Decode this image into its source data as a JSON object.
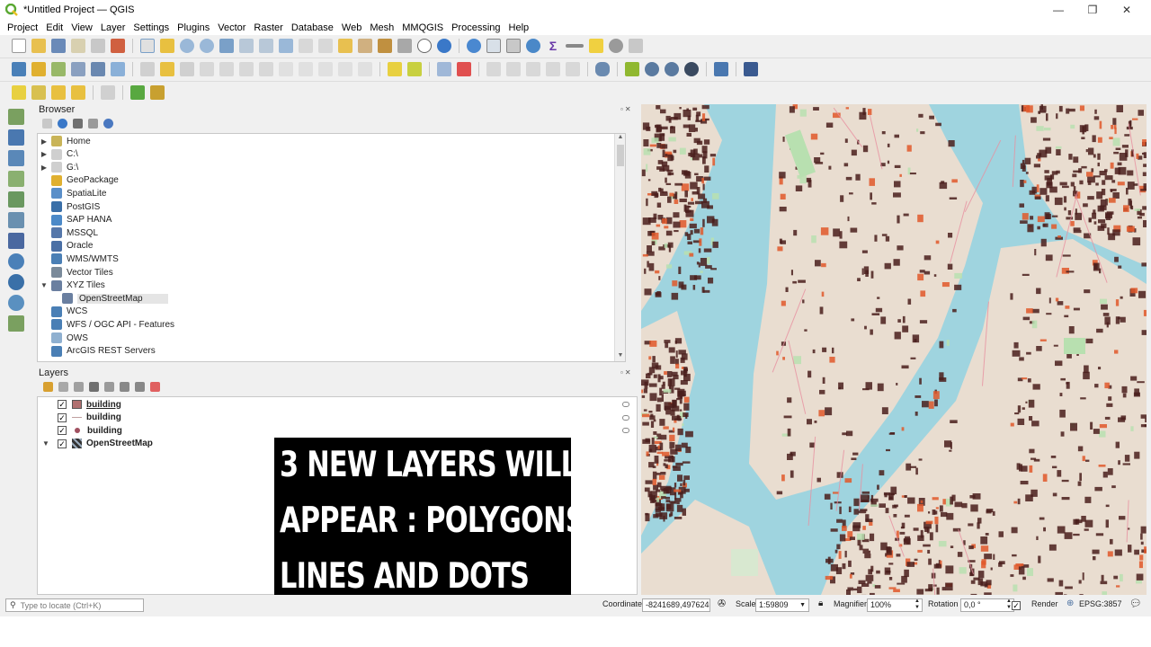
{
  "window": {
    "title": "*Untitled Project — QGIS",
    "minimize": "—",
    "maximize": "❐",
    "close": "✕"
  },
  "menu": [
    "Project",
    "Edit",
    "View",
    "Layer",
    "Settings",
    "Plugins",
    "Vector",
    "Raster",
    "Database",
    "Web",
    "Mesh",
    "MMQGIS",
    "Processing",
    "Help"
  ],
  "browser": {
    "title": "Browser",
    "items": [
      {
        "label": "Home",
        "arrow": "▶",
        "indent": 0,
        "icon": "home-folder-icon",
        "color": "#c9b458"
      },
      {
        "label": "C:\\",
        "arrow": "▶",
        "indent": 0,
        "icon": "folder-icon",
        "color": "#cfcfcf"
      },
      {
        "label": "G:\\",
        "arrow": "▶",
        "indent": 0,
        "icon": "folder-icon",
        "color": "#cfcfcf"
      },
      {
        "label": "GeoPackage",
        "arrow": "",
        "indent": 0,
        "icon": "geopackage-icon",
        "color": "#e0b030"
      },
      {
        "label": "SpatiaLite",
        "arrow": "",
        "indent": 0,
        "icon": "spatialite-icon",
        "color": "#5a8fc9"
      },
      {
        "label": "PostGIS",
        "arrow": "",
        "indent": 0,
        "icon": "postgis-elephant-icon",
        "color": "#3a6fa8"
      },
      {
        "label": "SAP HANA",
        "arrow": "",
        "indent": 0,
        "icon": "sap-hana-icon",
        "color": "#4b89c8"
      },
      {
        "label": "MSSQL",
        "arrow": "",
        "indent": 0,
        "icon": "mssql-icon",
        "color": "#5577aa"
      },
      {
        "label": "Oracle",
        "arrow": "",
        "indent": 0,
        "icon": "oracle-icon",
        "color": "#4a6fa5"
      },
      {
        "label": "WMS/WMTS",
        "arrow": "",
        "indent": 0,
        "icon": "globe-icon",
        "color": "#4a7fb5"
      },
      {
        "label": "Vector Tiles",
        "arrow": "",
        "indent": 0,
        "icon": "grid-icon",
        "color": "#7a8a9a"
      },
      {
        "label": "XYZ Tiles",
        "arrow": "▼",
        "indent": 0,
        "icon": "grid-icon",
        "color": "#6a7fa0"
      },
      {
        "label": "OpenStreetMap",
        "arrow": "",
        "indent": 1,
        "icon": "tiles-grid-icon",
        "color": "#6a7fa0",
        "selected": true
      },
      {
        "label": "WCS",
        "arrow": "",
        "indent": 0,
        "icon": "globe-icon",
        "color": "#4a7fb5"
      },
      {
        "label": "WFS / OGC API - Features",
        "arrow": "",
        "indent": 0,
        "icon": "globe-icon",
        "color": "#4a7fb5"
      },
      {
        "label": "OWS",
        "arrow": "",
        "indent": 0,
        "icon": "globe-icon",
        "color": "#8fb0d0"
      },
      {
        "label": "ArcGIS REST Servers",
        "arrow": "",
        "indent": 0,
        "icon": "globe-icon",
        "color": "#4a7fb5"
      }
    ]
  },
  "layers": {
    "title": "Layers",
    "items": [
      {
        "label": "building",
        "symbol": "polygon-symbol-icon",
        "color": "#b07070",
        "checked": "✓",
        "underline": true
      },
      {
        "label": "building",
        "symbol": "line-symbol-icon",
        "color": "#c0a0a0",
        "checked": "✓",
        "underline": false
      },
      {
        "label": "building",
        "symbol": "point-symbol-icon",
        "color": "#a05060",
        "checked": "✓",
        "underline": false
      },
      {
        "label": "OpenStreetMap",
        "symbol": "raster-tiles-icon",
        "color": "#333",
        "checked": "✓",
        "underline": false,
        "arrow": "▼"
      }
    ]
  },
  "caption": {
    "line1": "3 NEW LAYERS WILL",
    "line2": "APPEAR : POLYGONS,",
    "line3": "LINES AND DOTS"
  },
  "map": {
    "water_color": "#9fd4df",
    "land_color": "#e9ddd0",
    "building_color": "#4a1f1c",
    "accent_color": "#e0582a",
    "park_color": "#b8e0b0"
  },
  "statusbar": {
    "locate_placeholder": "Type to locate (Ctrl+K)",
    "coordinate_label": "Coordinate",
    "coordinate_value": "-8241689,4976249",
    "scale_label": "Scale",
    "scale_value": "1:59809",
    "magnifier_label": "Magnifier",
    "magnifier_value": "100%",
    "rotation_label": "Rotation",
    "rotation_value": "0,0 °",
    "render_label": "Render",
    "render_checked": "✓",
    "crs": "EPSG:3857"
  },
  "dock_buttons": "▫✕"
}
